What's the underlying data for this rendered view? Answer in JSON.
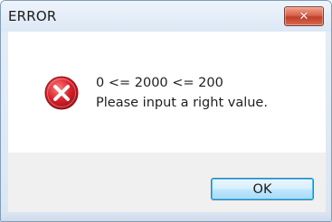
{
  "window": {
    "title": "ERROR",
    "close_icon": "close-icon"
  },
  "message": {
    "icon": "error-icon",
    "line1": "0 <= 2000 <= 200",
    "line2": "Please input a right value."
  },
  "buttons": {
    "ok_label": "OK"
  },
  "colors": {
    "error_red": "#d8202a",
    "close_red": "#c13e2a",
    "button_border": "#3c7fb1"
  }
}
